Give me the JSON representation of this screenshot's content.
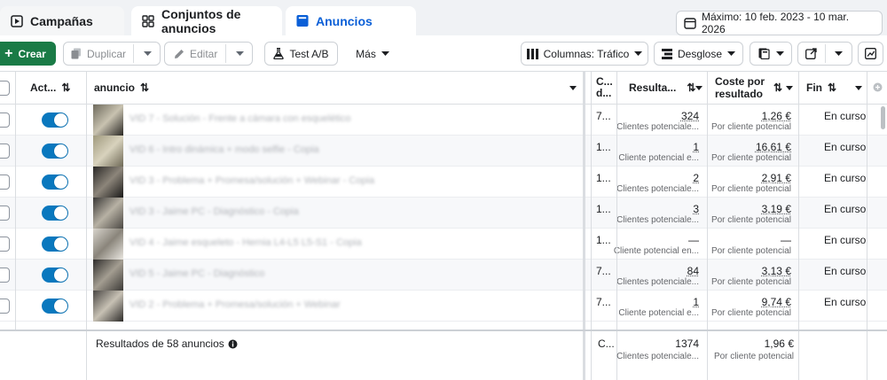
{
  "tabs": [
    {
      "label": "Campañas",
      "icon": "campaign-icon"
    },
    {
      "label": "Conjuntos de anuncios",
      "icon": "grid-icon"
    },
    {
      "label": "Anuncios",
      "icon": "ad-icon"
    }
  ],
  "date_range": {
    "label": "Máximo: 10 feb. 2023 - 10 mar. 2026",
    "icon": "calendar-icon"
  },
  "toolbar": {
    "create": "Crear",
    "duplicate": "Duplicar",
    "edit": "Editar",
    "ab_test": "Test A/B",
    "more": "Más",
    "columns": "Columnas: Tráfico",
    "breakdown": "Desglose"
  },
  "headers": {
    "active": "Act...",
    "ad": "anuncio",
    "c": "C... d...",
    "results": "Resulta...",
    "cost": "Coste por resultado",
    "end": "Fin"
  },
  "rows": [
    {
      "name": "VID 7 - Solución - Frente a cámara con esquelético",
      "c": "7...",
      "results": "324",
      "results_sub": "Clientes potenciale...",
      "cost": "1,26 €",
      "cost_sub": "Por cliente potencial",
      "end": "En curso"
    },
    {
      "name": "VID 6 - Intro dinámica + modo selfie - Copia",
      "c": "1...",
      "results": "1",
      "results_sub": "Cliente potencial e...",
      "cost": "16,61 €",
      "cost_sub": "Por cliente potencial",
      "end": "En curso"
    },
    {
      "name": "VID 3 - Problema + Promesa/solución + Webinar - Copia",
      "c": "1...",
      "results": "2",
      "results_sub": "Clientes potenciale...",
      "cost": "2,91 €",
      "cost_sub": "Por cliente potencial",
      "end": "En curso"
    },
    {
      "name": "VID 3 - Jaime PC - Diagnóstico - Copia",
      "c": "1...",
      "results": "3",
      "results_sub": "Clientes potenciale...",
      "cost": "3,19 €",
      "cost_sub": "Por cliente potencial",
      "end": "En curso"
    },
    {
      "name": "VID 4 - Jaime esqueleto - Hernia L4-L5 L5-S1 - Copia",
      "c": "1...",
      "results": "—",
      "results_sub": "Cliente potencial en...",
      "cost": "—",
      "cost_sub": "Por cliente potencial",
      "end": "En curso"
    },
    {
      "name": "VID 5 - Jaime PC - Diagnóstico",
      "c": "7...",
      "results": "84",
      "results_sub": "Clientes potenciale...",
      "cost": "3,13 €",
      "cost_sub": "Por cliente potencial",
      "end": "En curso"
    },
    {
      "name": "VID 2 - Problema + Promesa/solución + Webinar",
      "c": "7...",
      "results": "1",
      "results_sub": "Cliente potencial e...",
      "cost": "9,74 €",
      "cost_sub": "Por cliente potencial",
      "end": "En curso"
    }
  ],
  "footer": {
    "summary": "Resultados de 58 anuncios",
    "c": "C...",
    "results": "1374",
    "results_sub": "Clientes potenciale...",
    "cost": "1,96 €",
    "cost_sub": "Por cliente potencial"
  }
}
